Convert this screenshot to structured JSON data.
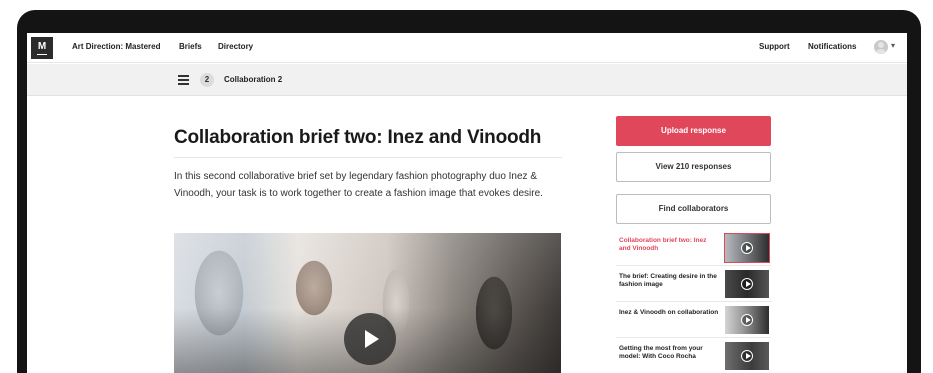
{
  "topnav": {
    "logo": "M",
    "app_title": "Art Direction: Mastered",
    "links": [
      "Briefs",
      "Directory"
    ],
    "support": "Support",
    "notifications": "Notifications"
  },
  "subnav": {
    "step": "2",
    "title": "Collaboration 2"
  },
  "main": {
    "title": "Collaboration brief two: Inez and Vinoodh",
    "intro": "In this second collaborative brief set by legendary fashion photography duo Inez & Vinoodh, your task is to work together to create a fashion image that evokes desire."
  },
  "sidebar": {
    "upload_label": "Upload response",
    "view_label": "View 210 responses",
    "find_label": "Find collaborators",
    "items": [
      {
        "label": "Collaboration brief two: Inez and Vinoodh",
        "active": true
      },
      {
        "label": "The brief: Creating desire in the fashion image",
        "active": false
      },
      {
        "label": "Inez & Vinoodh on collaboration",
        "active": false
      },
      {
        "label": "Getting the most from your model: With Coco Rocha",
        "active": false
      }
    ]
  },
  "colors": {
    "accent": "#e0475a",
    "bezel": "#141414"
  }
}
